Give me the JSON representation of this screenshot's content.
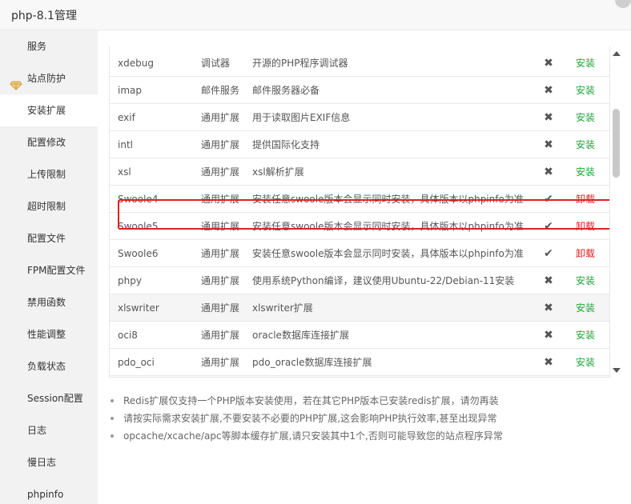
{
  "window": {
    "title": "php-8.1管理"
  },
  "sidebar": {
    "items": [
      {
        "label": "服务"
      },
      {
        "label": "站点防护"
      },
      {
        "label": "安装扩展"
      },
      {
        "label": "配置修改"
      },
      {
        "label": "上传限制"
      },
      {
        "label": "超时限制"
      },
      {
        "label": "配置文件"
      },
      {
        "label": "FPM配置文件"
      },
      {
        "label": "禁用函数"
      },
      {
        "label": "性能调整"
      },
      {
        "label": "负载状态"
      },
      {
        "label": "Session配置"
      },
      {
        "label": "日志"
      },
      {
        "label": "慢日志"
      },
      {
        "label": "phpinfo"
      }
    ],
    "active": "安装扩展"
  },
  "extensions": {
    "rows": [
      {
        "name": "xdebug",
        "type": "调试器",
        "desc": "开源的PHP程序调试器",
        "status": "not-installed",
        "status_icon": "✖",
        "action": "安装"
      },
      {
        "name": "imap",
        "type": "邮件服务",
        "desc": "邮件服务器必备",
        "status": "not-installed",
        "status_icon": "✖",
        "action": "安装"
      },
      {
        "name": "exif",
        "type": "通用扩展",
        "desc": "用于读取图片EXIF信息",
        "status": "not-installed",
        "status_icon": "✖",
        "action": "安装"
      },
      {
        "name": "intl",
        "type": "通用扩展",
        "desc": "提供国际化支持",
        "status": "not-installed",
        "status_icon": "✖",
        "action": "安装"
      },
      {
        "name": "xsl",
        "type": "通用扩展",
        "desc": "xsl解析扩展",
        "status": "not-installed",
        "status_icon": "✖",
        "action": "安装"
      },
      {
        "name": "Swoole4",
        "type": "通用扩展",
        "desc": "安装任意swoole版本会显示同时安装，具体版本以phpinfo为准",
        "status": "installed",
        "status_icon": "✔",
        "action": "卸载"
      },
      {
        "name": "Swoole5",
        "type": "通用扩展",
        "desc": "安装任意swoole版本会显示同时安装，具体版本以phpinfo为准",
        "status": "installed",
        "status_icon": "✔",
        "action": "卸载"
      },
      {
        "name": "Swoole6",
        "type": "通用扩展",
        "desc": "安装任意swoole版本会显示同时安装，具体版本以phpinfo为准",
        "status": "installed",
        "status_icon": "✔",
        "action": "卸载"
      },
      {
        "name": "phpy",
        "type": "通用扩展",
        "desc": "使用系统Python编译，建议使用Ubuntu-22/Debian-11安装",
        "status": "not-installed",
        "status_icon": "✖",
        "action": "安装"
      },
      {
        "name": "xlswriter",
        "type": "通用扩展",
        "desc": "xlswriter扩展",
        "status": "not-installed",
        "status_icon": "✖",
        "action": "安装"
      },
      {
        "name": "oci8",
        "type": "通用扩展",
        "desc": "oracle数据库连接扩展",
        "status": "not-installed",
        "status_icon": "✖",
        "action": "安装"
      },
      {
        "name": "pdo_oci",
        "type": "通用扩展",
        "desc": "pdo_oracle数据库连接扩展",
        "status": "not-installed",
        "status_icon": "✖",
        "action": "安装"
      }
    ]
  },
  "notes": [
    "Redis扩展仅支持一个PHP版本安装使用，若在其它PHP版本已安装redis扩展，请勿再装",
    "请按实际需求安装扩展,不要安装不必要的PHP扩展,这会影响PHP执行效率,甚至出现异常",
    "opcache/xcache/apc等脚本缓存扩展,请只安装其中1个,否则可能导致您的站点程序异常"
  ],
  "colors": {
    "install": "#20a53a",
    "uninstall": "#e02020",
    "highlight_border": "#e02020"
  }
}
